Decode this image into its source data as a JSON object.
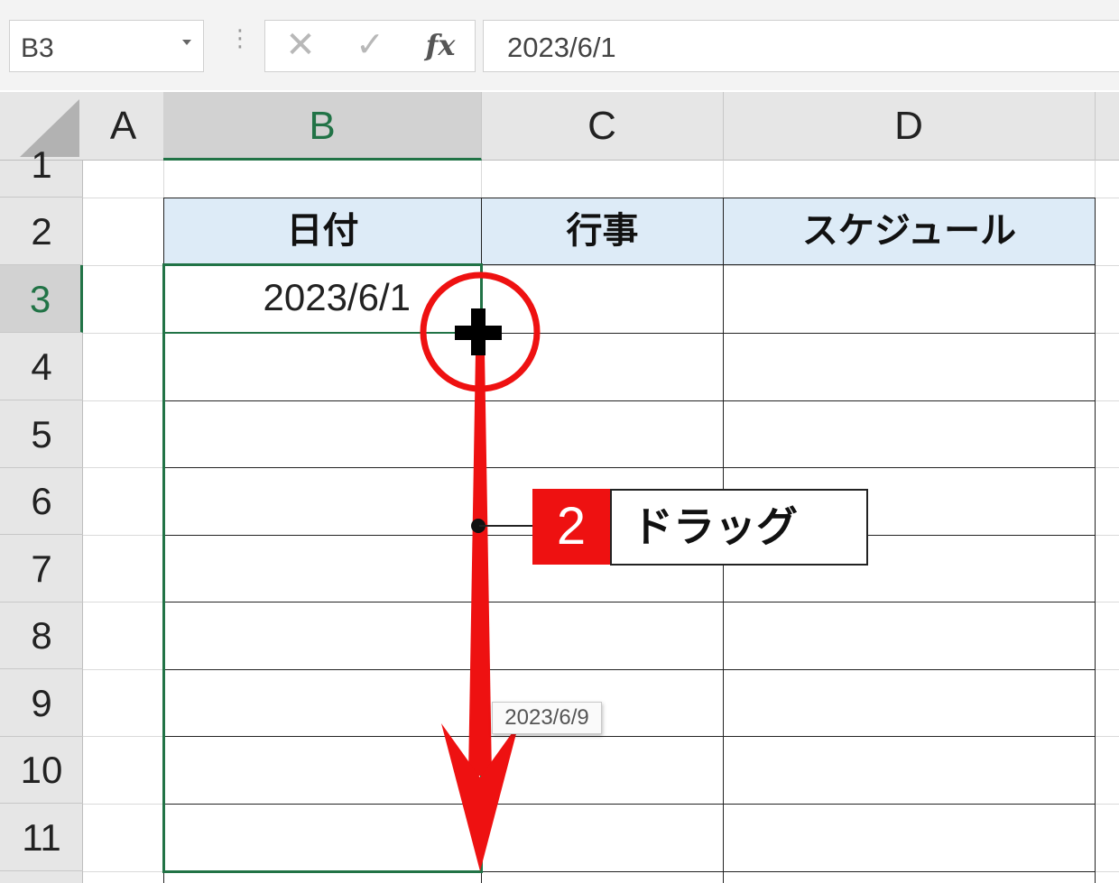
{
  "formula_bar": {
    "name_box": "B3",
    "cancel_icon": "close-icon",
    "enter_icon": "check-icon",
    "fx_label": "fx",
    "formula": "2023/6/1"
  },
  "columns": [
    "A",
    "B",
    "C",
    "D"
  ],
  "rows": [
    "1",
    "2",
    "3",
    "4",
    "5",
    "6",
    "7",
    "8",
    "9",
    "10",
    "11"
  ],
  "table": {
    "headers": [
      "日付",
      "行事",
      "スケジュール"
    ],
    "b3_value": "2023/6/1"
  },
  "fill_tooltip": "2023/6/9",
  "callout": {
    "number": "2",
    "text": "ドラッグ"
  },
  "colors": {
    "accent_red": "#ee1111",
    "selection_green": "#217346",
    "header_fill": "#ddebf7"
  },
  "icons": [
    "close-icon",
    "check-icon",
    "function-icon",
    "fill-handle-cursor-icon",
    "down-arrow-icon"
  ]
}
